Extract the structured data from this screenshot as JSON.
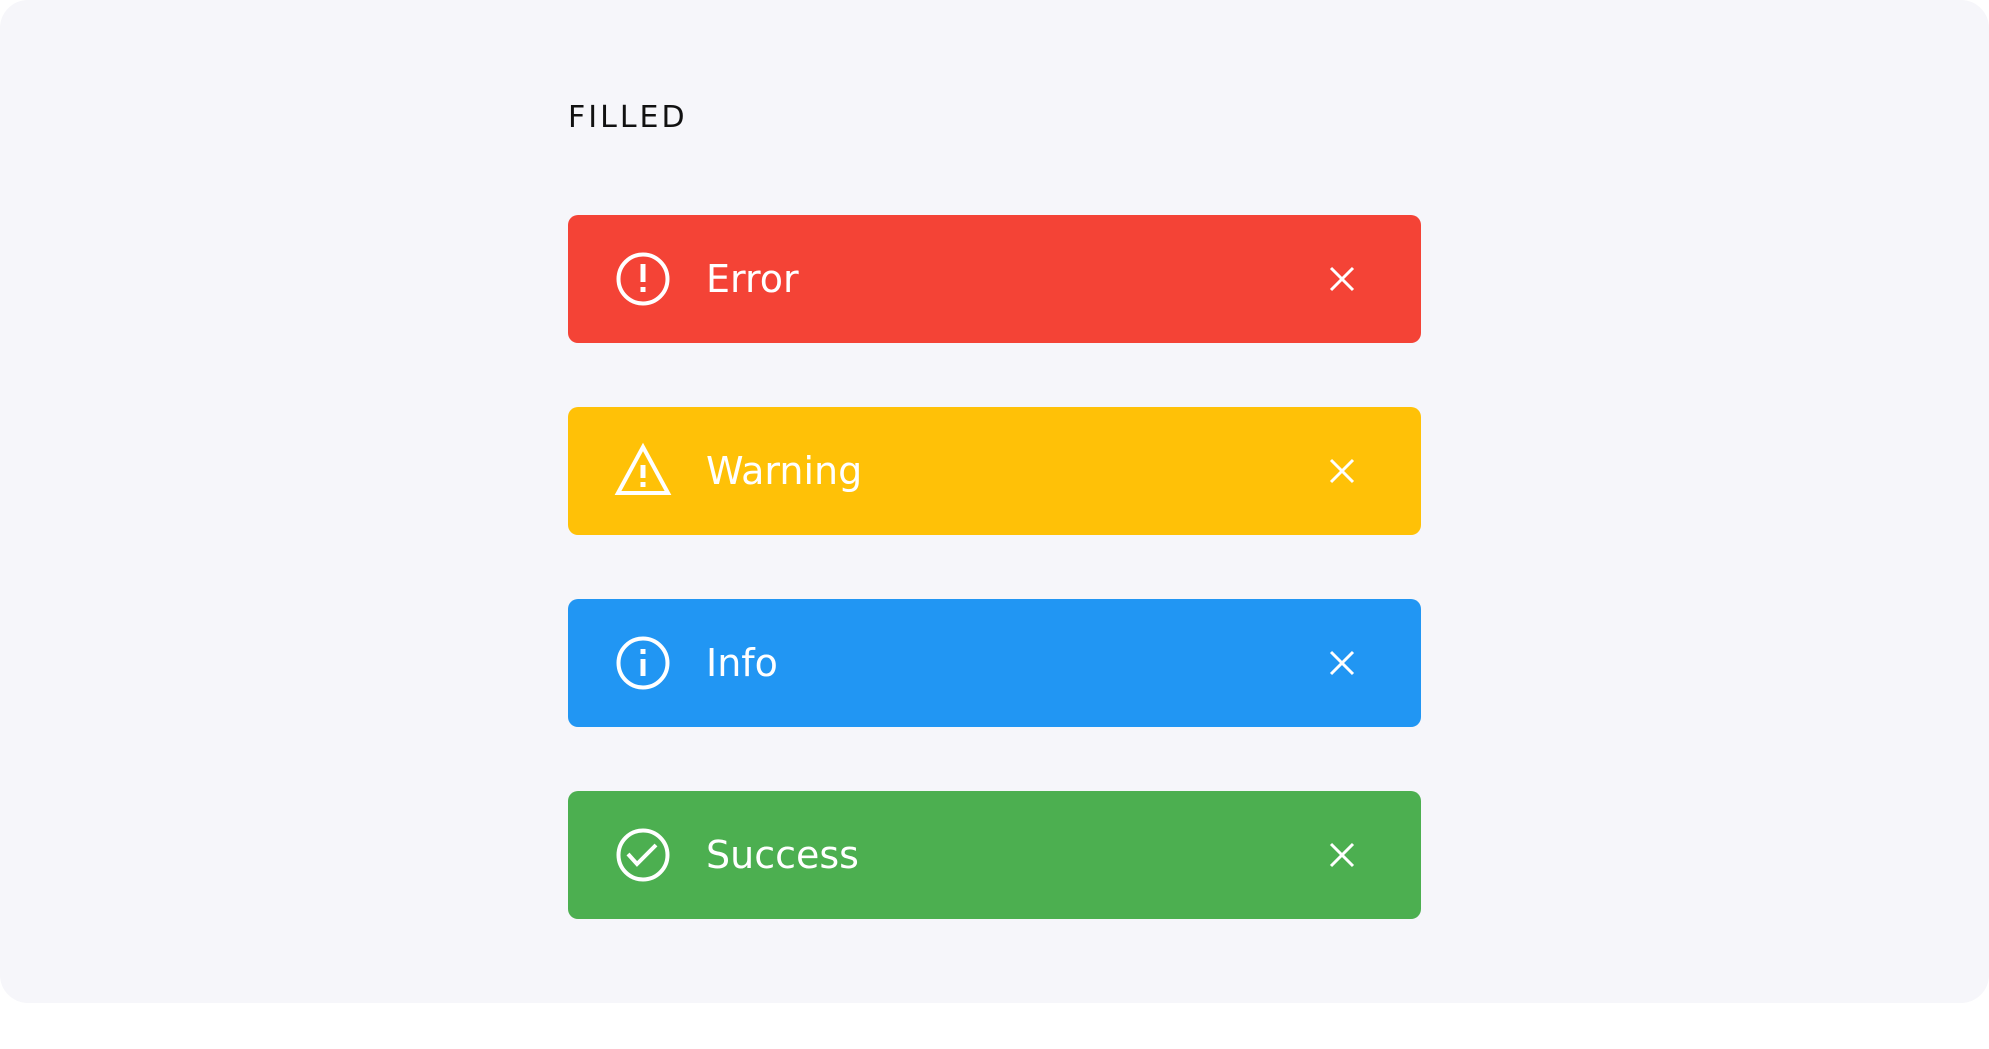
{
  "section": {
    "title": "FILLED"
  },
  "alerts": [
    {
      "label": "Error",
      "color": "#f44336",
      "icon": "error-circle-icon",
      "close_icon": "close-icon"
    },
    {
      "label": "Warning",
      "color": "#ffc107",
      "icon": "warning-triangle-icon",
      "close_icon": "close-icon"
    },
    {
      "label": "Info",
      "color": "#2196f3",
      "icon": "info-circle-icon",
      "close_icon": "close-icon"
    },
    {
      "label": "Success",
      "color": "#4caf50",
      "icon": "check-circle-icon",
      "close_icon": "close-icon"
    }
  ]
}
